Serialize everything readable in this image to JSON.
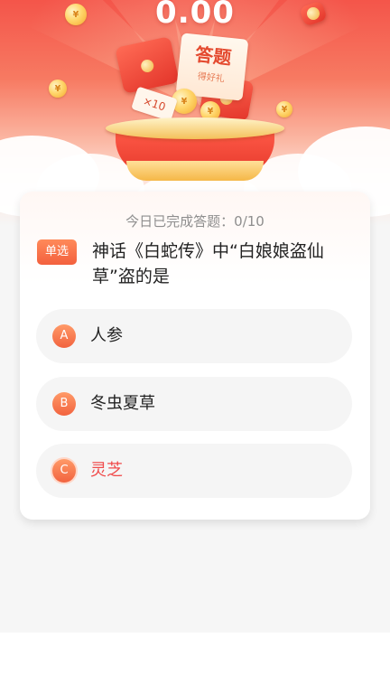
{
  "header": {
    "balance": "0.00",
    "ticket_title": "答题",
    "ticket_subtitle": "得好礼",
    "ticket_tag": "×10"
  },
  "quiz": {
    "progress_text": "今日已完成答题：0/10",
    "type_badge": "单选",
    "question": "神话《白蛇传》中“白娘娘盗仙草”盗的是",
    "options": [
      {
        "letter": "A",
        "text": "人参",
        "selected": false
      },
      {
        "letter": "B",
        "text": "冬虫夏草",
        "selected": false
      },
      {
        "letter": "C",
        "text": "灵芝",
        "selected": true
      }
    ]
  },
  "colors": {
    "accent": "#f3603d",
    "selected_text": "#f04b4b",
    "hero_top": "#f4554a"
  },
  "icons": [
    "coin-icon",
    "red-envelope-icon",
    "gift-basket-icon"
  ]
}
